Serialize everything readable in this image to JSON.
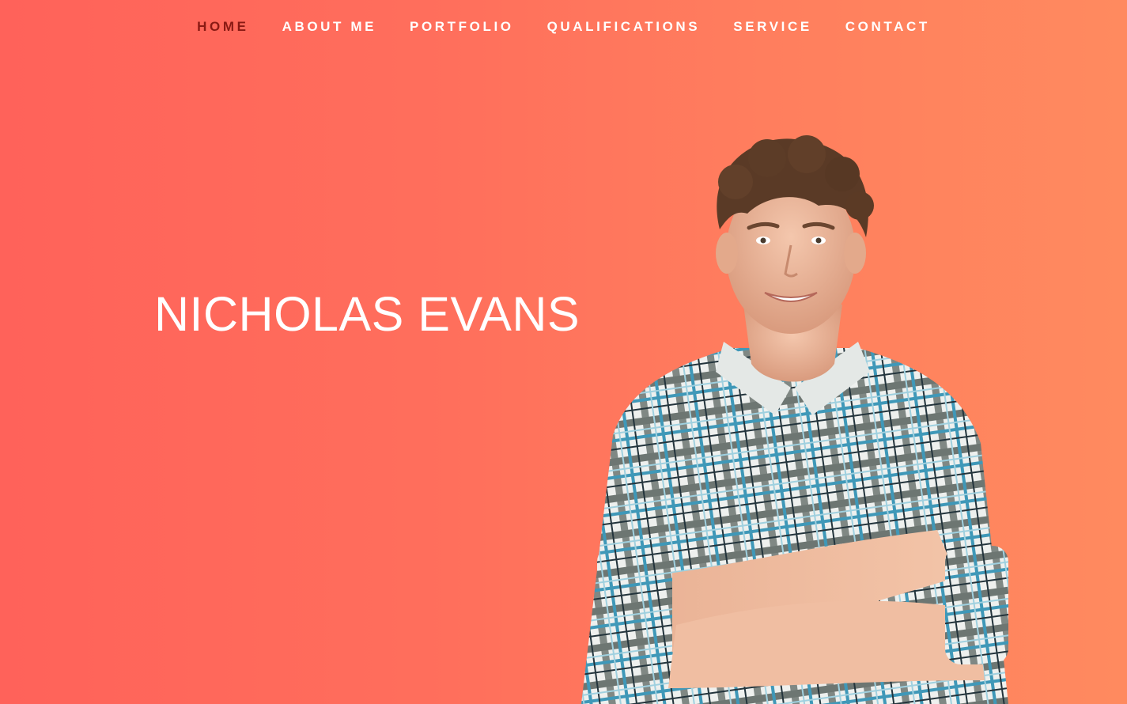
{
  "nav": {
    "items": [
      {
        "label": "HOME",
        "active": true
      },
      {
        "label": "ABOUT ME",
        "active": false
      },
      {
        "label": "PORTFOLIO",
        "active": false
      },
      {
        "label": "QUALIFICATIONS",
        "active": false
      },
      {
        "label": "SERVICE",
        "active": false
      },
      {
        "label": "CONTACT",
        "active": false
      }
    ]
  },
  "hero": {
    "name": "NICHOLAS EVANS",
    "colors": {
      "gradient_start": "#ff625a",
      "gradient_end": "#ff8a5f",
      "active_nav": "#8a1a14",
      "text": "#ffffff"
    }
  }
}
